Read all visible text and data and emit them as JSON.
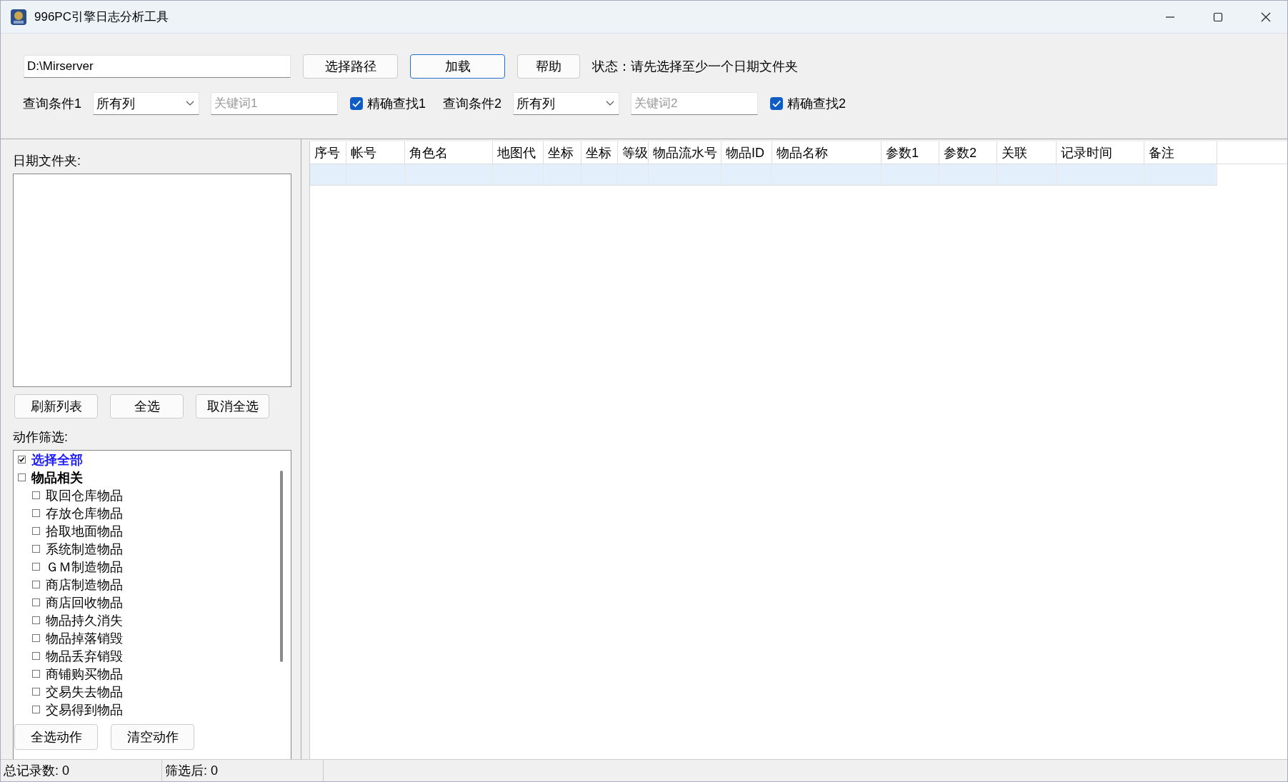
{
  "window": {
    "title": "996PC引擎日志分析工具"
  },
  "toolbar": {
    "path_value": "D:\\Mirserver",
    "buttons": [
      {
        "label": "选择路径",
        "focused": false
      },
      {
        "label": "加载",
        "focused": true
      },
      {
        "label": "帮助",
        "focused": false
      }
    ],
    "status": "状态：请先选择至少一个日期文件夹"
  },
  "queries": [
    {
      "label": "查询条件1",
      "column": "所有列",
      "placeholder": "关键词1",
      "exact_label": "精确查找1",
      "exact_checked": true
    },
    {
      "label": "查询条件2",
      "column": "所有列",
      "placeholder": "关键词2",
      "exact_label": "精确查找2",
      "exact_checked": true
    }
  ],
  "date_folders": {
    "label": "日期文件夹:",
    "buttons": [
      "刷新列表",
      "全选",
      "取消全选"
    ]
  },
  "action_filter": {
    "label": "动作筛选:",
    "items": [
      {
        "label": "选择全部",
        "kind": "all",
        "checked": true
      },
      {
        "label": "物品相关",
        "kind": "group",
        "checked": false,
        "children": [
          {
            "label": "取回仓库物品",
            "kind": "item",
            "checked": false
          },
          {
            "label": "存放仓库物品",
            "kind": "item",
            "checked": false
          },
          {
            "label": "拾取地面物品",
            "kind": "item",
            "checked": false
          },
          {
            "label": "系统制造物品",
            "kind": "item",
            "checked": false
          },
          {
            "label": "ＧＭ制造物品",
            "kind": "item",
            "checked": false
          },
          {
            "label": "商店制造物品",
            "kind": "item",
            "checked": false
          },
          {
            "label": "商店回收物品",
            "kind": "item",
            "checked": false
          },
          {
            "label": "物品持久消失",
            "kind": "item",
            "checked": false
          },
          {
            "label": "物品掉落销毁",
            "kind": "item",
            "checked": false
          },
          {
            "label": "物品丢弃销毁",
            "kind": "item",
            "checked": false
          },
          {
            "label": "商铺购买物品",
            "kind": "item",
            "checked": false
          },
          {
            "label": "交易失去物品",
            "kind": "item",
            "checked": false
          },
          {
            "label": "交易得到物品",
            "kind": "item",
            "checked": false
          }
        ]
      }
    ],
    "buttons": [
      "全选动作",
      "清空动作"
    ]
  },
  "table": {
    "columns": [
      "序号",
      "帐号",
      "角色名",
      "地图代",
      "坐标",
      "坐标",
      "等级",
      "物品流水号",
      "物品ID",
      "物品名称",
      "参数1",
      "参数2",
      "关联",
      "记录时间",
      "备注"
    ],
    "rows": [
      {
        "selected": true
      }
    ]
  },
  "status_bar": [
    "总记录数: 0",
    "筛选后: 0"
  ]
}
